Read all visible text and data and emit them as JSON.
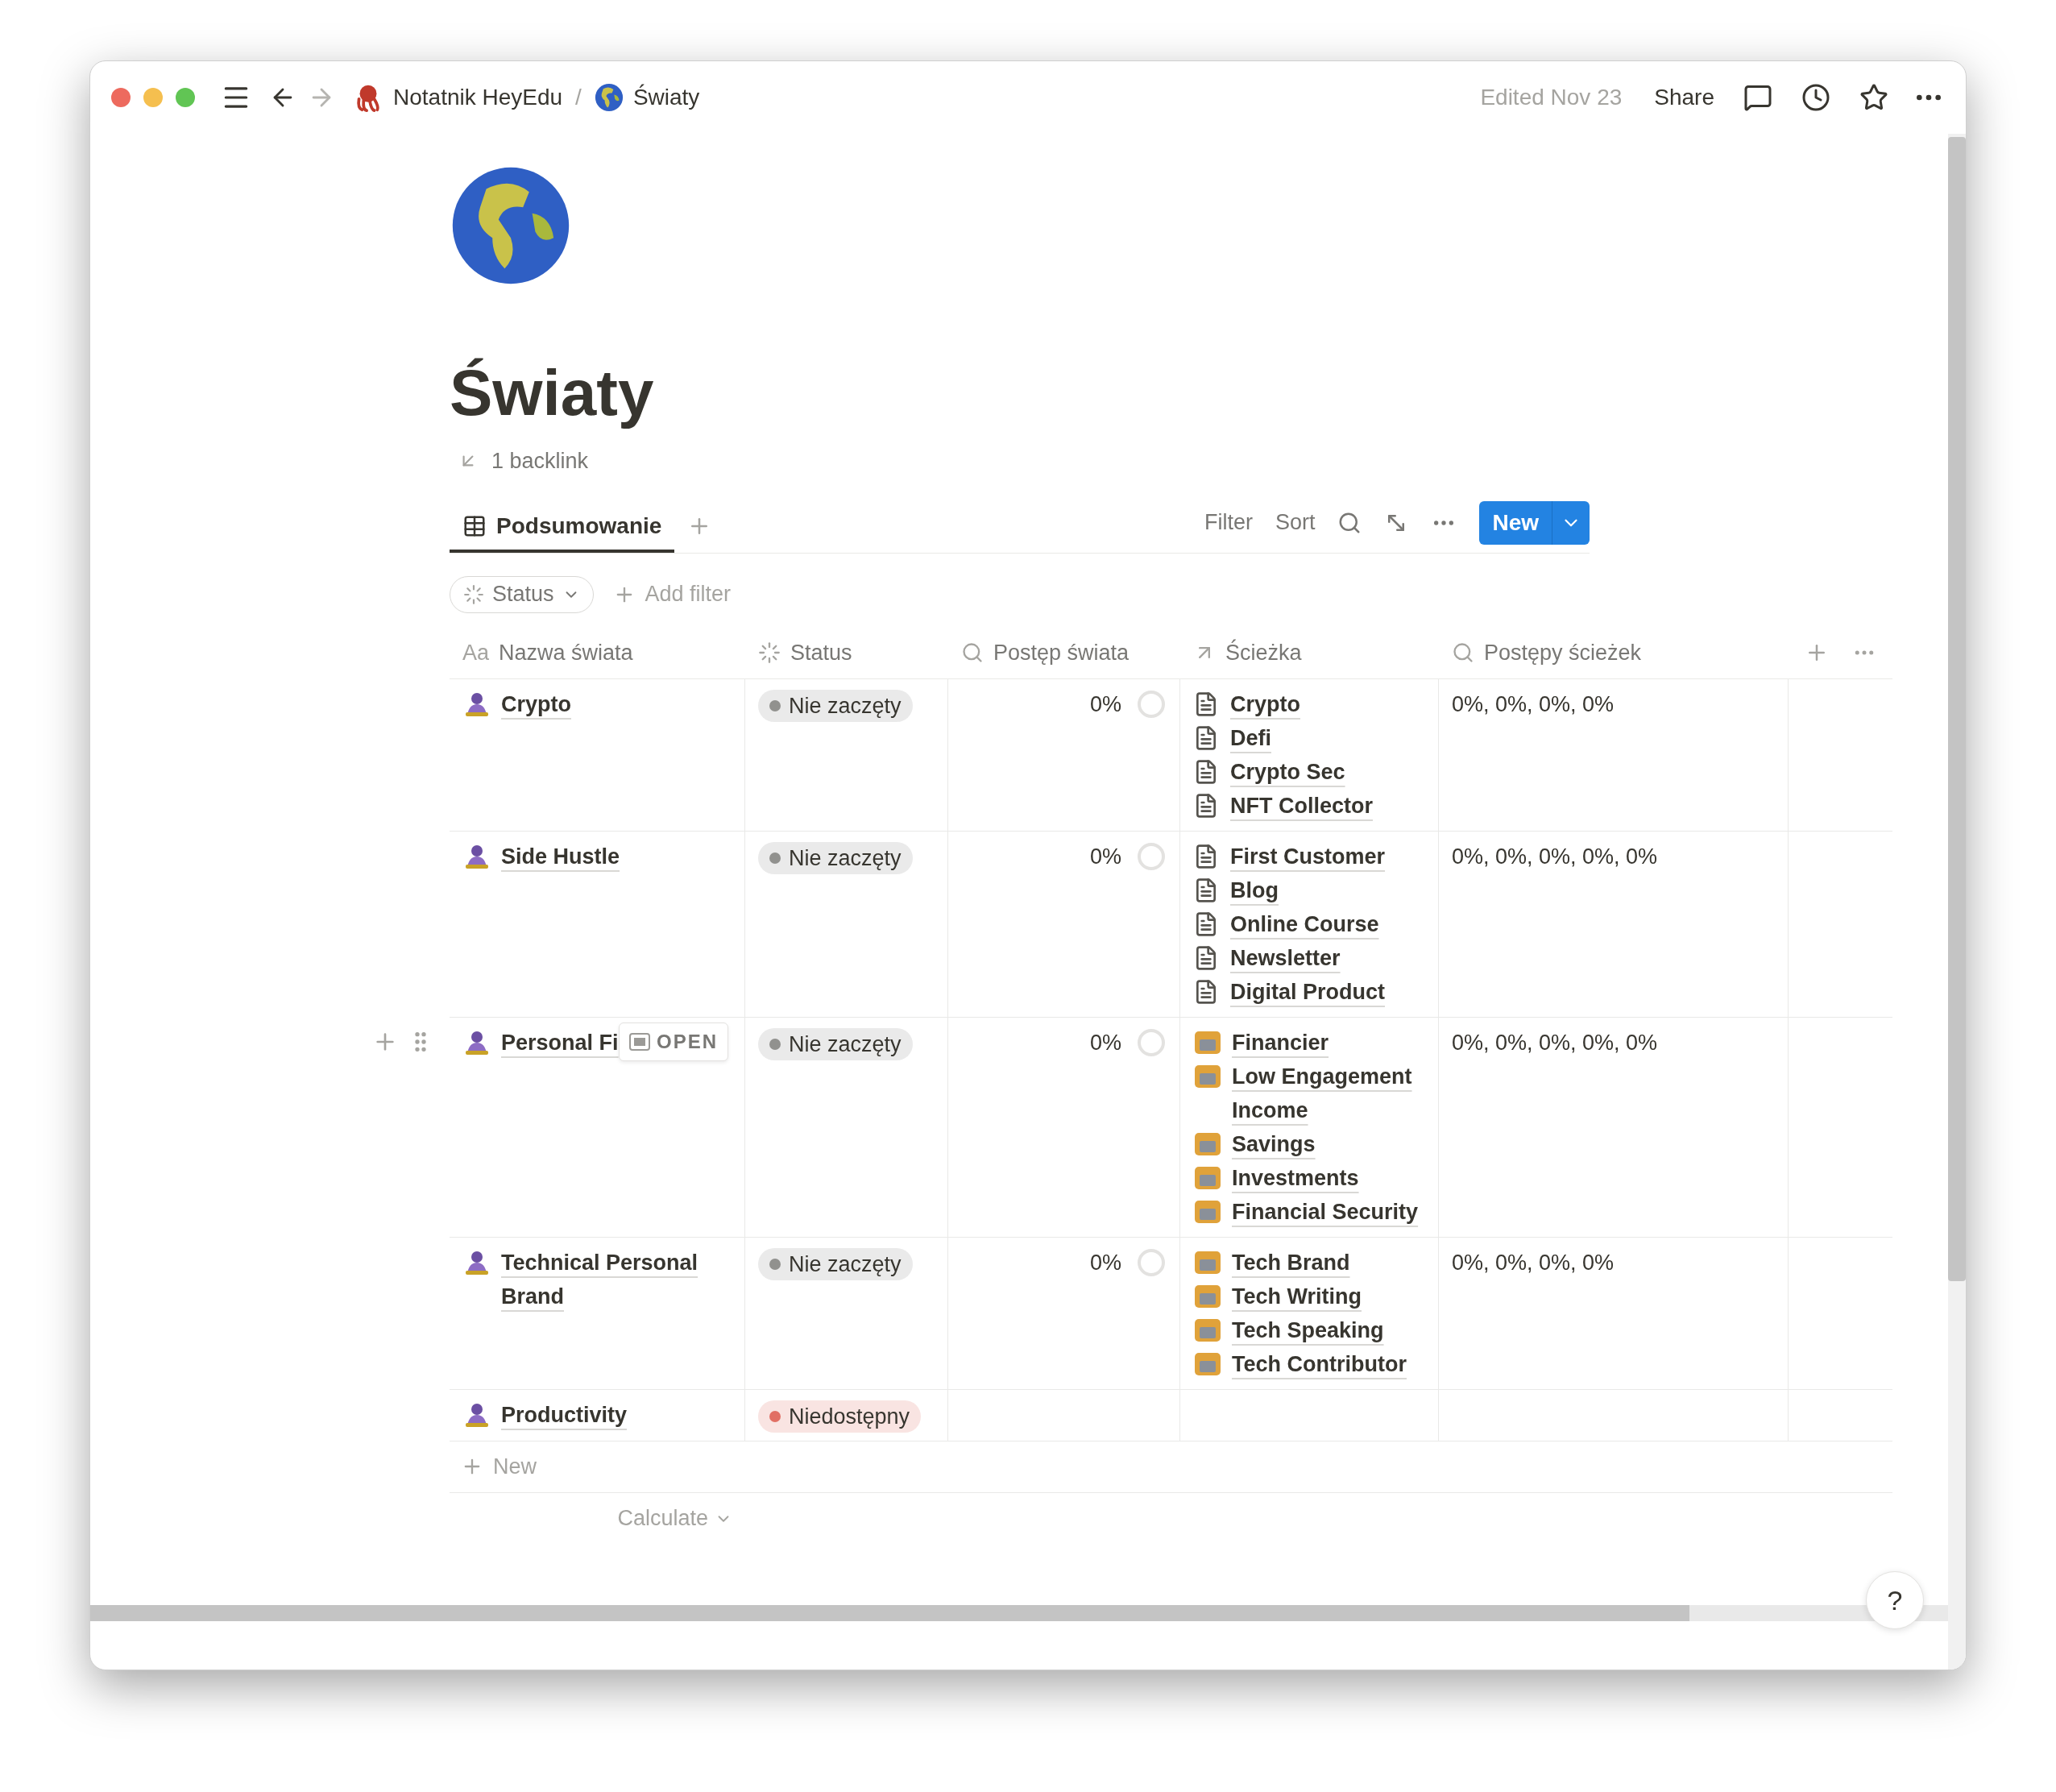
{
  "window": {
    "breadcrumbs": [
      {
        "text": "Notatnik HeyEdu"
      },
      {
        "text": "Światy"
      }
    ],
    "separator": "/",
    "edited": "Edited Nov 23",
    "share": "Share"
  },
  "page": {
    "title": "Światy",
    "backlinks": "1 backlink"
  },
  "views": [
    {
      "label": "Podsumowanie",
      "selected": true
    }
  ],
  "toolbar": {
    "filter": "Filter",
    "sort": "Sort",
    "new": "New"
  },
  "filters": {
    "chip": "Status",
    "add": "Add filter"
  },
  "columns": [
    {
      "kind": "title",
      "prefix": "Aa",
      "label": "Nazwa świata"
    },
    {
      "kind": "status",
      "label": "Status"
    },
    {
      "kind": "rollup",
      "label": "Postęp świata"
    },
    {
      "kind": "relation",
      "label": "Ścieżka"
    },
    {
      "kind": "rollup",
      "label": "Postępy ścieżek"
    }
  ],
  "rows": [
    {
      "name": "Crypto",
      "hovered": false,
      "status": {
        "label": "Nie zaczęty",
        "color": "#91918e"
      },
      "progress": {
        "text": "0%"
      },
      "paths": [
        {
          "kind": "page",
          "label": "Crypto"
        },
        {
          "kind": "page",
          "label": "Defi"
        },
        {
          "kind": "page",
          "label": "Crypto Sec"
        },
        {
          "kind": "page",
          "label": "NFT Collector"
        }
      ],
      "path_progress": "0%, 0%, 0%, 0%"
    },
    {
      "name": "Side Hustle",
      "hovered": false,
      "status": {
        "label": "Nie zaczęty",
        "color": "#91918e"
      },
      "progress": {
        "text": "0%"
      },
      "paths": [
        {
          "kind": "page",
          "label": "First Customer"
        },
        {
          "kind": "page",
          "label": "Blog"
        },
        {
          "kind": "page",
          "label": "Online Course"
        },
        {
          "kind": "page",
          "label": "Newsletter"
        },
        {
          "kind": "page",
          "label": "Digital Product"
        }
      ],
      "path_progress": "0%, 0%, 0%, 0%, 0%"
    },
    {
      "name": "Personal Fi",
      "hovered": true,
      "status": {
        "label": "Nie zaczęty",
        "color": "#91918e"
      },
      "progress": {
        "text": "0%"
      },
      "paths": [
        {
          "kind": "emoji",
          "label": "Financier"
        },
        {
          "kind": "emoji",
          "label": "Low Engagement Income"
        },
        {
          "kind": "emoji",
          "label": "Savings"
        },
        {
          "kind": "emoji",
          "label": "Investments"
        },
        {
          "kind": "emoji",
          "label": "Financial Security"
        }
      ],
      "path_progress": "0%, 0%, 0%, 0%, 0%"
    },
    {
      "name": "Technical Personal Brand",
      "hovered": false,
      "status": {
        "label": "Nie zaczęty",
        "color": "#91918e"
      },
      "progress": {
        "text": "0%"
      },
      "paths": [
        {
          "kind": "emoji",
          "label": "Tech Brand"
        },
        {
          "kind": "emoji",
          "label": "Tech Writing"
        },
        {
          "kind": "emoji",
          "label": "Tech Speaking"
        },
        {
          "kind": "emoji",
          "label": "Tech Contributor"
        }
      ],
      "path_progress": "0%, 0%, 0%, 0%"
    },
    {
      "name": "Productivity",
      "hovered": false,
      "status": {
        "label": "Niedostępny",
        "color": "#e16f64"
      }
    }
  ],
  "open_label": "OPEN",
  "new_row": "New",
  "calculate": "Calculate",
  "help": "?"
}
